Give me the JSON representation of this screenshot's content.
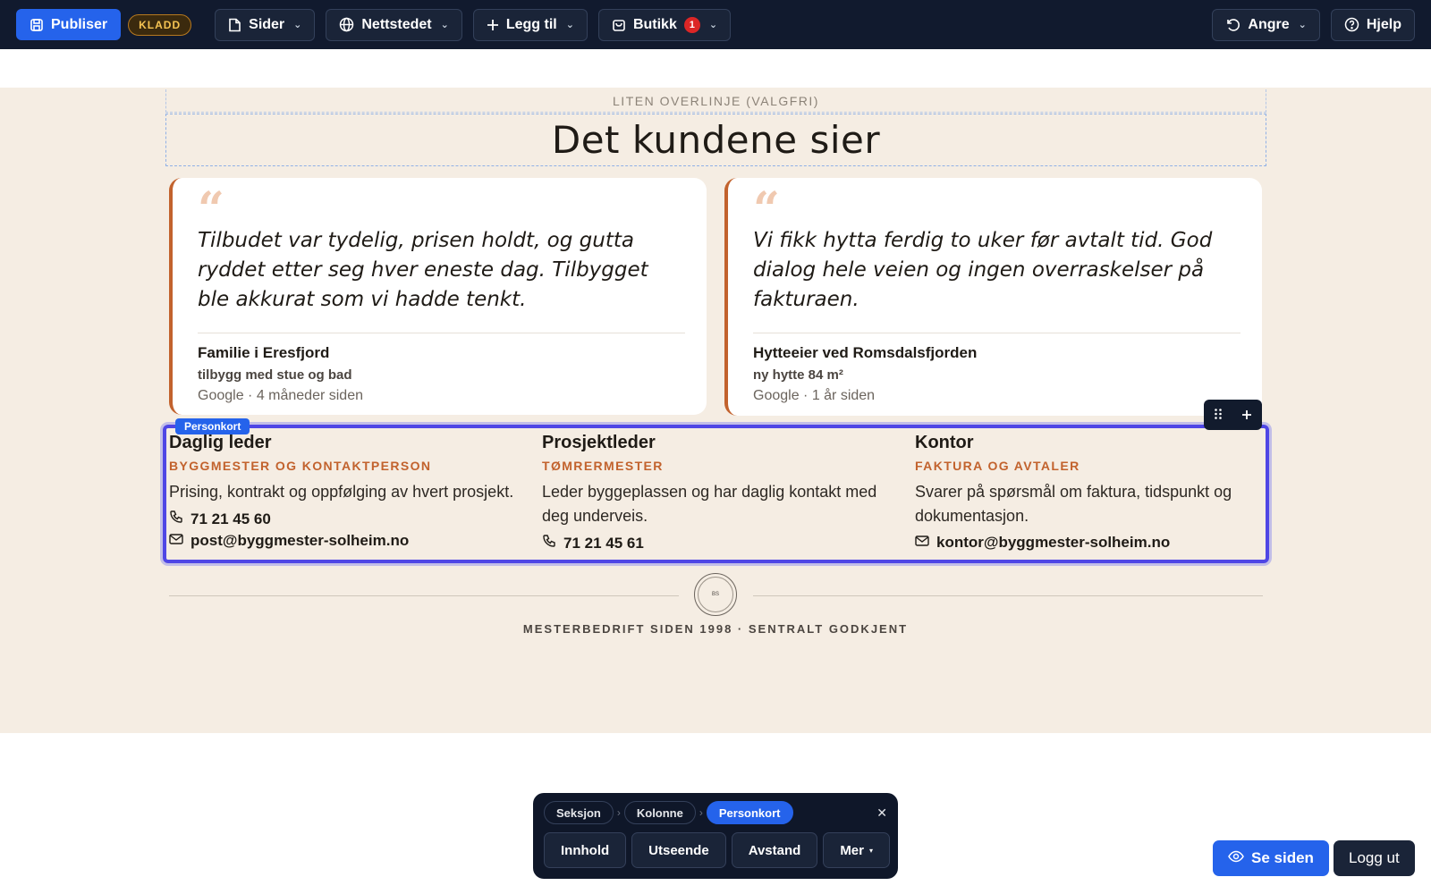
{
  "toolbar": {
    "publish_label": "Publiser",
    "draft_badge": "KLADD",
    "pages_label": "Sider",
    "site_label": "Nettstedet",
    "add_label": "Legg til",
    "shop_label": "Butikk",
    "shop_count": "1",
    "undo_label": "Angre",
    "help_label": "Hjelp",
    "primary_color": "#2563eb"
  },
  "section": {
    "overline": "LITEN OVERLINJE (VALGFRI)",
    "title": "Det kundene sier"
  },
  "testimonials": [
    {
      "quote_mark": "“",
      "quote": "Tilbudet var tydelig, prisen holdt, og gutta ryddet etter seg hver eneste dag. Tilbygget ble akkurat som vi hadde tenkt.",
      "author": "Familie i Eresfjord",
      "project": "tilbygg med stue og bad",
      "source": "Google · 4 måneder siden"
    },
    {
      "quote_mark": "“",
      "quote": "Vi fikk hytta ferdig to uker før avtalt tid. God dialog hele veien og ingen overraskelser på fakturaen.",
      "author": "Hytteeier ved Romsdalsfjorden",
      "project": "ny hytte 84 m²",
      "source": "Google · 1 år siden"
    }
  ],
  "persons": {
    "tag": "Personkort",
    "items": [
      {
        "title": "Daglig leder",
        "role": "BYGGMESTER OG KONTAKTPERSON",
        "desc": "Prising, kontrakt og oppfølging av hvert prosjekt.",
        "phone": "71 21 45 60",
        "email": "post@byggmester-solheim.no"
      },
      {
        "title": "Prosjektleder",
        "role": "TØMRERMESTER",
        "desc": "Leder byggeplassen og har daglig kontakt med deg underveis.",
        "phone": "71 21 45 61"
      },
      {
        "title": "Kontor",
        "role": "FAKTURA OG AVTALER",
        "desc": "Svarer på spørsmål om faktura, tidspunkt og dokumentasjon.",
        "email": "kontor@byggmester-solheim.no"
      }
    ]
  },
  "seal": {
    "initials": "BS"
  },
  "tagline": "MESTERBEDRIFT SIDEN 1998 · SENTRALT GODKJENT",
  "context_toolbar": {
    "crumbs": [
      "Seksjon",
      "Kolonne",
      "Personkort"
    ],
    "actions": [
      "Innhold",
      "Utseende",
      "Avstand",
      "Mer"
    ]
  },
  "footer_buttons": {
    "view_label": "Se siden",
    "logout_label": "Logg ut"
  }
}
